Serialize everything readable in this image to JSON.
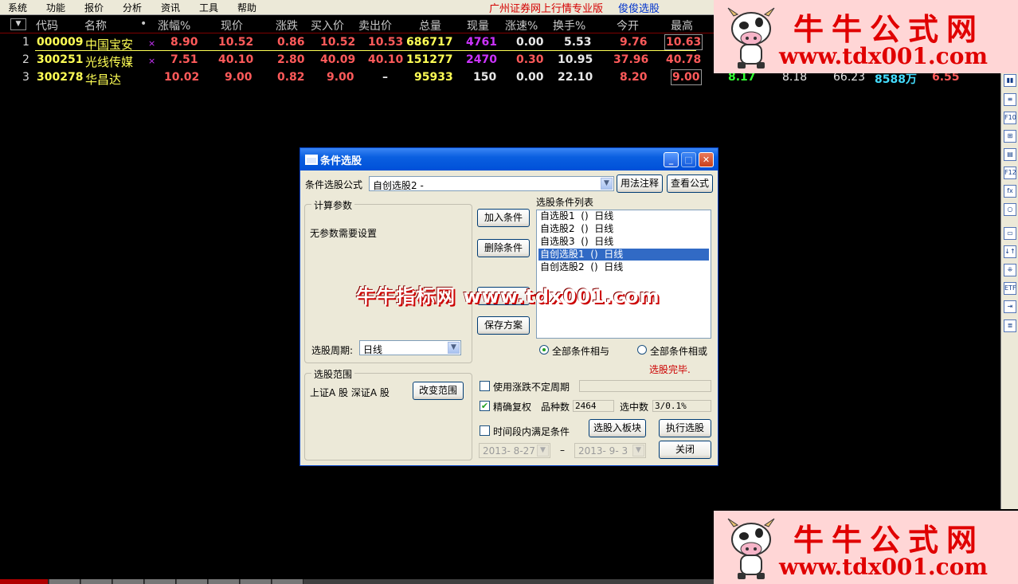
{
  "menu": {
    "items": [
      "系统",
      "功能",
      "报价",
      "分析",
      "资讯",
      "工具",
      "帮助"
    ],
    "brand": "广州证券网上行情专业版",
    "link": "俊俊选股"
  },
  "grid": {
    "sort_arrow": "▼",
    "headers": [
      "代码",
      "名称",
      "•",
      "涨幅%",
      "现价",
      "涨跌",
      "买入价",
      "卖出价",
      "总量",
      "现量",
      "涨速%",
      "换手%",
      "今开",
      "最高"
    ],
    "rows": [
      {
        "idx": "1",
        "code": "000009",
        "name": "中国宝安",
        "mark": "×",
        "pct": "8.90",
        "price": "10.52",
        "chg": "0.86",
        "bid": "10.52",
        "ask": "10.53",
        "vol": "686717",
        "cur": "4761",
        "spd": "0.00",
        "turn": "5.53",
        "open": "9.76",
        "high": "10.63"
      },
      {
        "idx": "2",
        "code": "300251",
        "name": "光线传媒",
        "mark": "×",
        "pct": "7.51",
        "price": "40.10",
        "chg": "2.80",
        "bid": "40.09",
        "ask": "40.10",
        "vol": "151277",
        "cur": "2470",
        "spd": "0.30",
        "turn": "10.95",
        "open": "37.96",
        "high": "40.78"
      },
      {
        "idx": "3",
        "code": "300278",
        "name": "华昌达",
        "mark": "",
        "pct": "10.02",
        "price": "9.00",
        "chg": "0.82",
        "bid": "9.00",
        "ask": "–",
        "vol": "95933",
        "cur": "150",
        "spd": "0.00",
        "turn": "22.10",
        "open": "8.20",
        "high": "9.00",
        "extra": [
          "8.17",
          "8.18",
          "66.23",
          "8588万",
          "6.55"
        ]
      }
    ]
  },
  "ad": {
    "line1": "牛牛公式网",
    "line2": "www.tdx001.com"
  },
  "dialog": {
    "title": "条件选股",
    "formula_label": "条件选股公式",
    "formula_value": "自创选股2 -",
    "usage_btn": "用法注释",
    "view_btn": "查看公式",
    "params_group": "计算参数",
    "no_params": "无参数需要设置",
    "add_btn": "加入条件",
    "del_btn": "删除条件",
    "save_btn": "保存方案",
    "list_title": "选股条件列表",
    "conditions": [
      "自选股1  ()  日线",
      "自选股2  ()  日线",
      "自选股3  ()  日线",
      "自创选股1  ()  日线",
      "自创选股2  ()  日线"
    ],
    "selected_index": 3,
    "period_label": "选股周期:",
    "period_value": "日线",
    "radio_and": "全部条件相与",
    "radio_or": "全部条件相或",
    "status": "选股完毕.",
    "range_group": "选股范围",
    "range_value": "上证A 股  深证A 股",
    "range_btn": "改变范围",
    "chk_uncertain": "使用涨跌不定周期",
    "chk_adjust": "精确复权",
    "count_label": "品种数",
    "count_value": "2464",
    "selected_label": "选中数",
    "selected_value": "3/0.1%",
    "chk_timerange": "时间段内满足条件",
    "to_block_btn": "选股入板块",
    "exec_btn": "执行选股",
    "close_btn": "关闭",
    "date_from": "2013- 8-27",
    "date_sep": "–",
    "date_to": "2013- 9- 3",
    "watermark": "牛牛指标网 www.tdx001.com"
  },
  "colors": {
    "up": "#ff5a5a",
    "yellow": "#ffff55",
    "magenta": "#cc33ff",
    "selection": "#316ac5",
    "titlebar": "#0a5fe0"
  }
}
